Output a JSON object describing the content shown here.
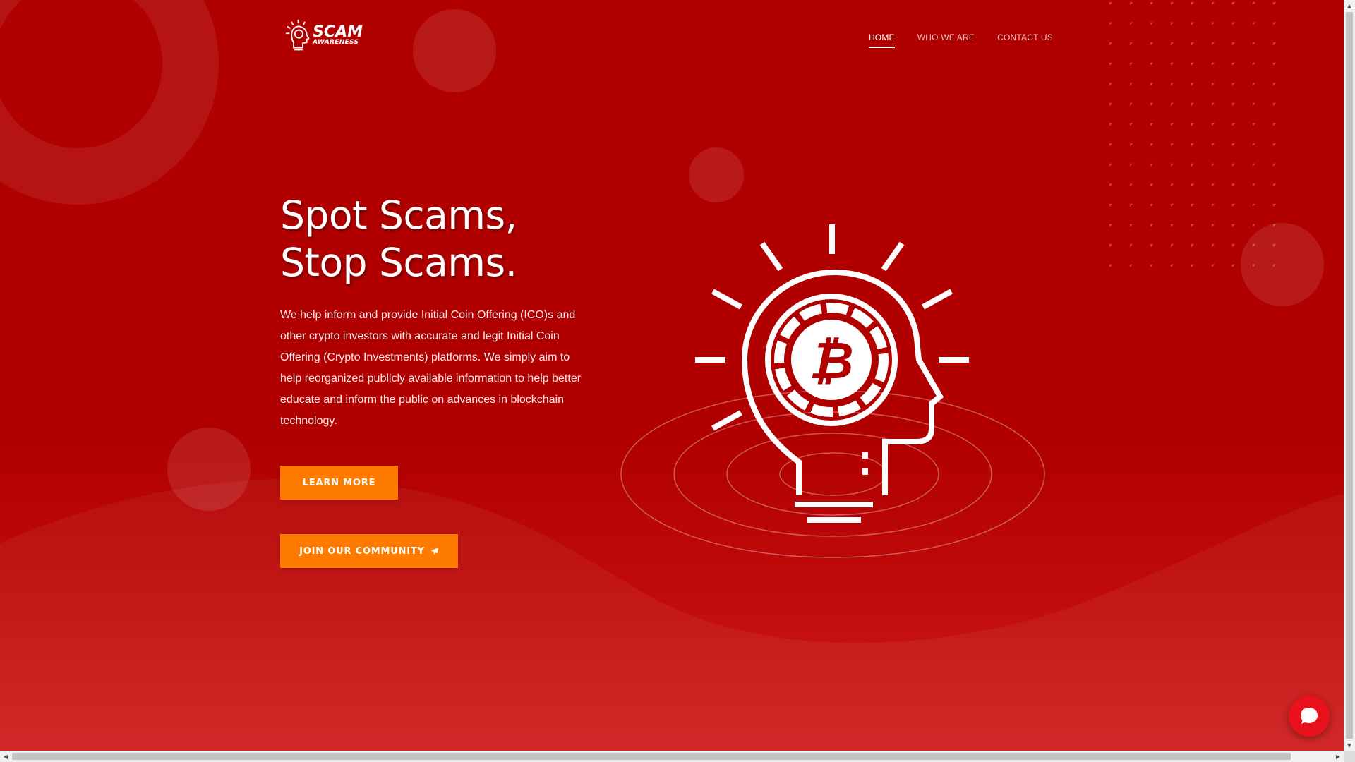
{
  "brand": {
    "logo_line1": "SCAM",
    "logo_line2": "AWARENESS"
  },
  "nav": {
    "items": [
      {
        "label": "HOME",
        "active": true
      },
      {
        "label": "WHO WE ARE",
        "active": false
      },
      {
        "label": "CONTACT US",
        "active": false
      }
    ]
  },
  "hero": {
    "title_line1": "Spot Scams,",
    "title_line2": "Stop Scams.",
    "description": "We help inform and provide Initial Coin Offering (ICO)s and other crypto investors with accurate and legit Initial Coin Offering (Crypto Investments) platforms. We simply aim to help reorganized publicly available information to help better educate and inform the public on advances in blockchain technology.",
    "learn_more_label": "LEARN MORE",
    "join_label": "JOIN OUR COMMUNITY",
    "join_icon": "paper-plane-icon"
  },
  "illustration": {
    "icon": "bitcoin-head-lightbulb-icon",
    "coin_symbol": "₿"
  },
  "chat": {
    "icon": "chat-bubble-icon"
  },
  "colors": {
    "background": "#b00000",
    "button": "#ff7b00",
    "chat_button": "#e8111c",
    "text": "#ffffff"
  }
}
